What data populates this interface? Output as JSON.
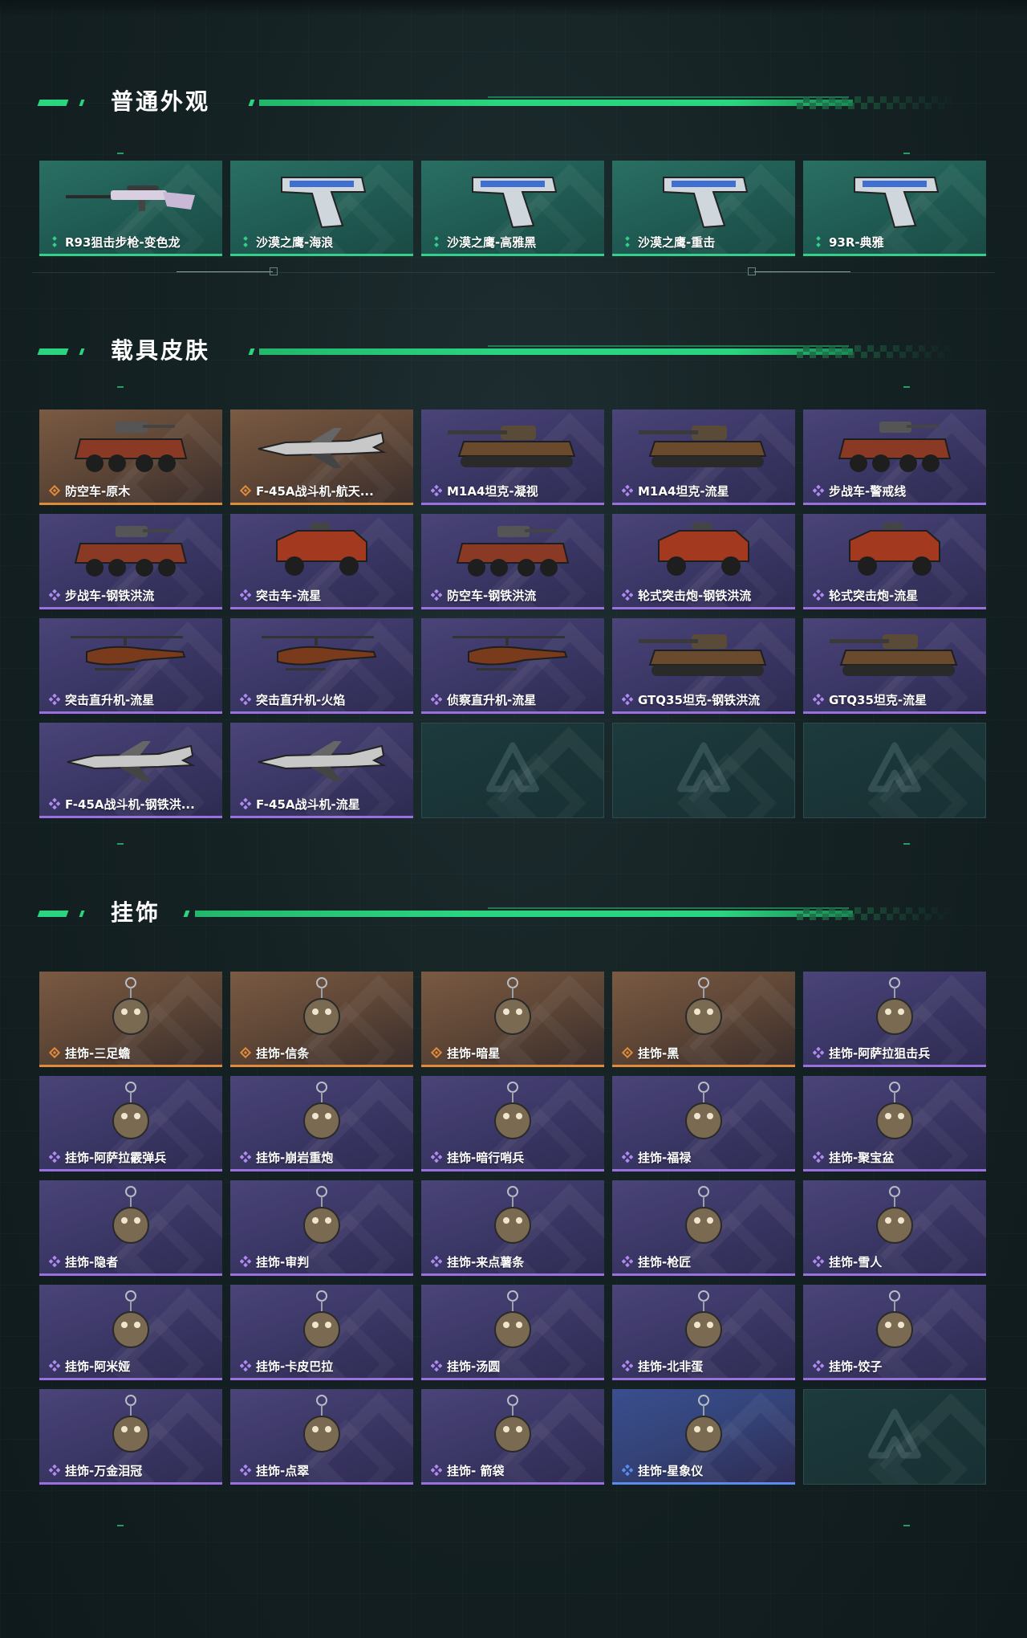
{
  "colors": {
    "accent_green": "#2bd47e",
    "rarity_green": "#32d08a",
    "rarity_orange": "#e08a3a",
    "rarity_purple": "#9a6fe0",
    "rarity_blue": "#5a8cf0"
  },
  "sections": [
    {
      "title": "普通外观",
      "items": [
        {
          "label": "R93狙击步枪-变色龙",
          "rarity": "green",
          "icon": "sniper-rifle-icon"
        },
        {
          "label": "沙漠之鹰-海浪",
          "rarity": "green",
          "icon": "pistol-icon"
        },
        {
          "label": "沙漠之鹰-高雅黑",
          "rarity": "green",
          "icon": "pistol-icon"
        },
        {
          "label": "沙漠之鹰-重击",
          "rarity": "green",
          "icon": "pistol-icon"
        },
        {
          "label": "93R-典雅",
          "rarity": "green",
          "icon": "pistol-icon"
        }
      ]
    },
    {
      "title": "载具皮肤",
      "items": [
        {
          "label": "防空车-原木",
          "rarity": "orange",
          "icon": "armored-car-icon"
        },
        {
          "label": "F-45A战斗机-航天...",
          "rarity": "orange",
          "icon": "fighter-jet-icon"
        },
        {
          "label": "M1A4坦克-凝视",
          "rarity": "purple",
          "icon": "tank-icon"
        },
        {
          "label": "M1A4坦克-流星",
          "rarity": "purple",
          "icon": "tank-icon"
        },
        {
          "label": "步战车-警戒线",
          "rarity": "purple",
          "icon": "armored-car-icon"
        },
        {
          "label": "步战车-钢铁洪流",
          "rarity": "purple",
          "icon": "armored-car-icon"
        },
        {
          "label": "突击车-流星",
          "rarity": "purple",
          "icon": "jeep-icon"
        },
        {
          "label": "防空车-钢铁洪流",
          "rarity": "purple",
          "icon": "armored-car-icon"
        },
        {
          "label": "轮式突击炮-钢铁洪流",
          "rarity": "purple",
          "icon": "jeep-icon"
        },
        {
          "label": "轮式突击炮-流星",
          "rarity": "purple",
          "icon": "jeep-icon"
        },
        {
          "label": "突击直升机-流星",
          "rarity": "purple",
          "icon": "helicopter-icon"
        },
        {
          "label": "突击直升机-火焰",
          "rarity": "purple",
          "icon": "helicopter-icon"
        },
        {
          "label": "侦察直升机-流星",
          "rarity": "purple",
          "icon": "helicopter-icon"
        },
        {
          "label": "GTQ35坦克-钢铁洪流",
          "rarity": "purple",
          "icon": "tank-icon"
        },
        {
          "label": "GTQ35坦克-流星",
          "rarity": "purple",
          "icon": "tank-icon"
        },
        {
          "label": "F-45A战斗机-钢铁洪...",
          "rarity": "purple",
          "icon": "fighter-jet-icon"
        },
        {
          "label": "F-45A战斗机-流星",
          "rarity": "purple",
          "icon": "fighter-jet-icon"
        },
        {
          "label": "",
          "rarity": "empty",
          "icon": "logo-icon"
        },
        {
          "label": "",
          "rarity": "empty",
          "icon": "logo-icon"
        },
        {
          "label": "",
          "rarity": "empty",
          "icon": "logo-icon"
        }
      ]
    },
    {
      "title": "挂饰",
      "items": [
        {
          "label": "挂饰-三足蟾",
          "rarity": "orange",
          "icon": "charm-icon"
        },
        {
          "label": "挂饰-信条",
          "rarity": "orange",
          "icon": "charm-icon"
        },
        {
          "label": "挂饰-暗星",
          "rarity": "orange",
          "icon": "charm-icon"
        },
        {
          "label": "挂饰-黑",
          "rarity": "orange",
          "icon": "charm-icon"
        },
        {
          "label": "挂饰-阿萨拉狙击兵",
          "rarity": "purple",
          "icon": "charm-icon"
        },
        {
          "label": "挂饰-阿萨拉霰弹兵",
          "rarity": "purple",
          "icon": "charm-icon"
        },
        {
          "label": "挂饰-崩岩重炮",
          "rarity": "purple",
          "icon": "charm-icon"
        },
        {
          "label": "挂饰-暗行哨兵",
          "rarity": "purple",
          "icon": "charm-icon"
        },
        {
          "label": "挂饰-福禄",
          "rarity": "purple",
          "icon": "charm-icon"
        },
        {
          "label": "挂饰-聚宝盆",
          "rarity": "purple",
          "icon": "charm-icon"
        },
        {
          "label": "挂饰-隐者",
          "rarity": "purple",
          "icon": "charm-icon"
        },
        {
          "label": "挂饰-审判",
          "rarity": "purple",
          "icon": "charm-icon"
        },
        {
          "label": "挂饰-来点薯条",
          "rarity": "purple",
          "icon": "charm-icon"
        },
        {
          "label": "挂饰-枪匠",
          "rarity": "purple",
          "icon": "charm-icon"
        },
        {
          "label": "挂饰-雪人",
          "rarity": "purple",
          "icon": "charm-icon"
        },
        {
          "label": "挂饰-阿米娅",
          "rarity": "purple",
          "icon": "charm-icon"
        },
        {
          "label": "挂饰-卡皮巴拉",
          "rarity": "purple",
          "icon": "charm-icon"
        },
        {
          "label": "挂饰-汤圆",
          "rarity": "purple",
          "icon": "charm-icon"
        },
        {
          "label": "挂饰-北非蛋",
          "rarity": "purple",
          "icon": "charm-icon"
        },
        {
          "label": "挂饰-饺子",
          "rarity": "purple",
          "icon": "charm-icon"
        },
        {
          "label": "挂饰-万金泪冠",
          "rarity": "purple",
          "icon": "charm-icon"
        },
        {
          "label": "挂饰-点翠",
          "rarity": "purple",
          "icon": "charm-icon"
        },
        {
          "label": "挂饰- 箭袋",
          "rarity": "purple",
          "icon": "charm-icon"
        },
        {
          "label": "挂饰-星象仪",
          "rarity": "blue",
          "icon": "charm-icon"
        },
        {
          "label": "",
          "rarity": "empty",
          "icon": "logo-icon"
        }
      ]
    }
  ]
}
